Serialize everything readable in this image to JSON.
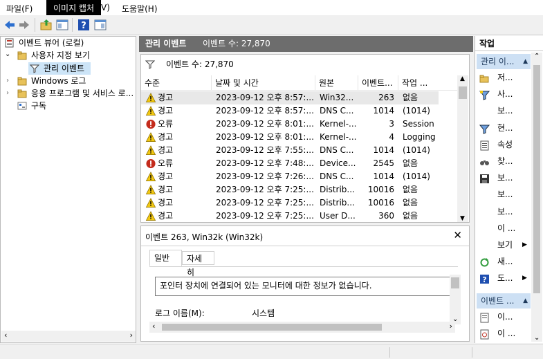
{
  "menubar": {
    "file": "파일(F)",
    "view_partial": "V)",
    "help": "도움말(H)",
    "tooltip": "이미지 캡처"
  },
  "toolbar": {
    "icons": [
      "back-icon",
      "forward-icon",
      "up-folder-icon",
      "show-hide-tree-icon",
      "help-icon",
      "show-hide-action-icon"
    ]
  },
  "tree": {
    "root": "이벤트 뷰어 (로컬)",
    "custom_views": "사용자 지정 보기",
    "admin_events": "관리 이벤트",
    "windows_logs": "Windows 로그",
    "app_service_logs": "응용 프로그램 및 서비스 로...",
    "subscriptions": "구독"
  },
  "center": {
    "header_title": "관리 이벤트",
    "header_count": "이벤트 수: 27,870",
    "filter_count": "이벤트 수: 27,870",
    "columns": [
      "수준",
      "날짜 및 시간",
      "원본",
      "이벤트...",
      "작업 ..."
    ],
    "rows": [
      {
        "level": "경고",
        "type": "warning",
        "datetime": "2023-09-12 오후 8:57:...",
        "source": "Win32...",
        "event_id": "263",
        "task": "없음"
      },
      {
        "level": "경고",
        "type": "warning",
        "datetime": "2023-09-12 오후 8:57:...",
        "source": "DNS C...",
        "event_id": "1014",
        "task": "(1014)"
      },
      {
        "level": "오류",
        "type": "error",
        "datetime": "2023-09-12 오후 8:01:...",
        "source": "Kernel-...",
        "event_id": "3",
        "task": "Session"
      },
      {
        "level": "경고",
        "type": "warning",
        "datetime": "2023-09-12 오후 8:01:...",
        "source": "Kernel-...",
        "event_id": "4",
        "task": "Logging"
      },
      {
        "level": "경고",
        "type": "warning",
        "datetime": "2023-09-12 오후 7:55:...",
        "source": "DNS C...",
        "event_id": "1014",
        "task": "(1014)"
      },
      {
        "level": "오류",
        "type": "error",
        "datetime": "2023-09-12 오후 7:48:...",
        "source": "Device...",
        "event_id": "2545",
        "task": "없음"
      },
      {
        "level": "경고",
        "type": "warning",
        "datetime": "2023-09-12 오후 7:26:...",
        "source": "DNS C...",
        "event_id": "1014",
        "task": "(1014)"
      },
      {
        "level": "경고",
        "type": "warning",
        "datetime": "2023-09-12 오후 7:25:...",
        "source": "Distrib...",
        "event_id": "10016",
        "task": "없음"
      },
      {
        "level": "경고",
        "type": "warning",
        "datetime": "2023-09-12 오후 7:25:...",
        "source": "Distrib...",
        "event_id": "10016",
        "task": "없음"
      },
      {
        "level": "경고",
        "type": "warning",
        "datetime": "2023-09-12 오후 7:25:...",
        "source": "User D...",
        "event_id": "360",
        "task": "없음"
      }
    ]
  },
  "detail": {
    "title": "이벤트 263, Win32k (Win32k)",
    "close": "✕",
    "tab_general": "일반",
    "tab_detail": "자세히",
    "description": "포인터 장치에 연결되어 있는 모니터에 대한 정보가 없습니다.",
    "log_label": "로그 이름(M):",
    "log_value": "시스템"
  },
  "actions": {
    "header": "작업",
    "section1": "관리 이...",
    "items": [
      {
        "label": "저...",
        "icon": "open-folder-icon"
      },
      {
        "label": "사...",
        "icon": "filter-icon"
      },
      {
        "label": "보...",
        "icon": ""
      },
      {
        "label": "현...",
        "icon": "filter-current-icon"
      },
      {
        "label": "속성",
        "icon": "properties-icon"
      },
      {
        "label": "찾...",
        "icon": "find-icon"
      },
      {
        "label": "보...",
        "icon": "save-icon"
      },
      {
        "label": "보...",
        "icon": ""
      },
      {
        "label": "보...",
        "icon": ""
      },
      {
        "label": "이 ...",
        "icon": ""
      },
      {
        "label": "보기",
        "icon": ""
      },
      {
        "label": "새...",
        "icon": "refresh-icon"
      },
      {
        "label": "도...",
        "icon": "help-icon"
      }
    ],
    "section2": "이벤트 ...",
    "items2": [
      {
        "label": "이...",
        "icon": "event-properties-icon"
      },
      {
        "label": "이 ...",
        "icon": "attach-task-icon"
      }
    ]
  }
}
